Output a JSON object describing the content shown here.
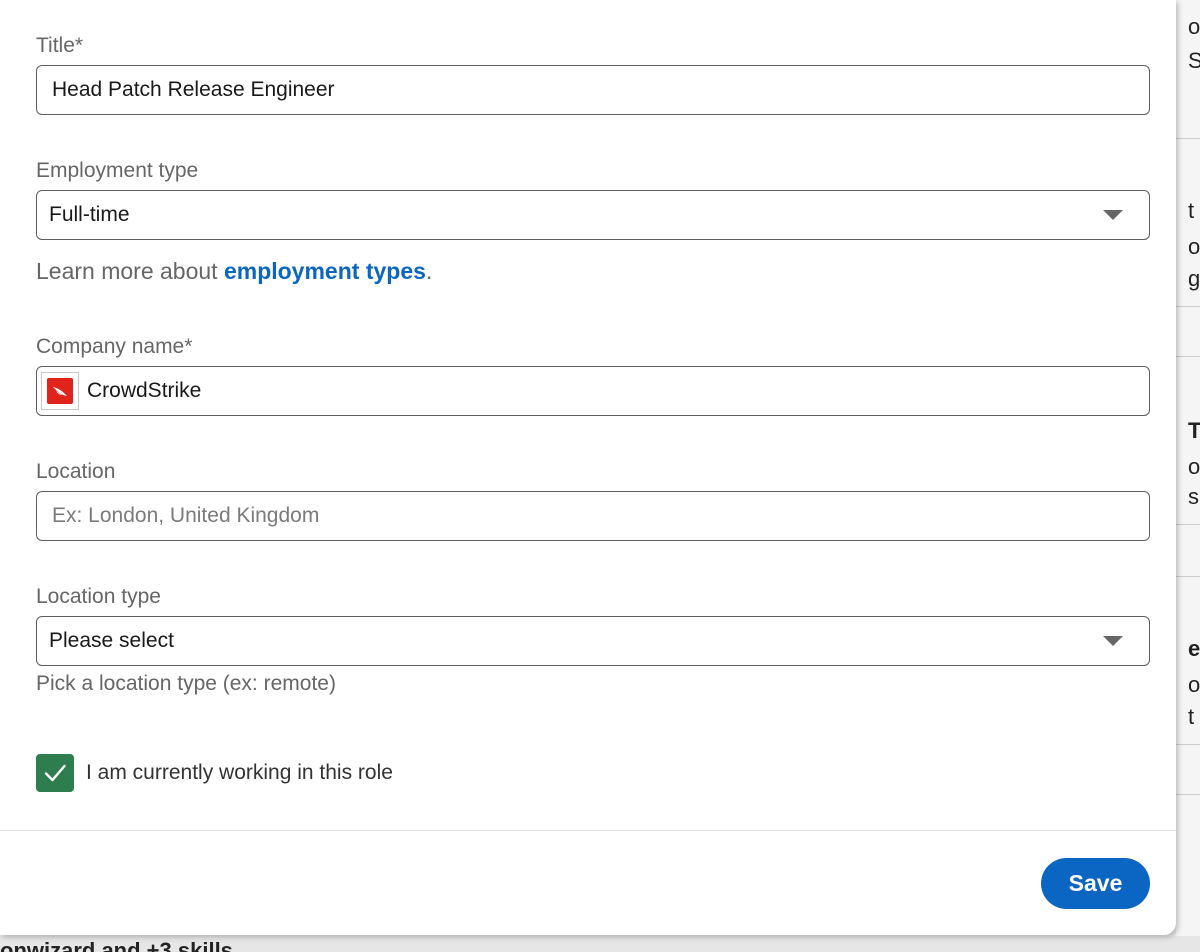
{
  "form": {
    "title_label": "Title*",
    "title_value": "Head Patch Release Engineer",
    "employment_type_label": "Employment type",
    "employment_type_value": "Full-time",
    "learn_more_prefix": "Learn more about ",
    "learn_more_link": "employment types",
    "learn_more_suffix": ".",
    "company_label": "Company name*",
    "company_value": "CrowdStrike",
    "company_logo_color": "#e0231b",
    "location_label": "Location",
    "location_placeholder": "Ex: London, United Kingdom",
    "location_type_label": "Location type",
    "location_type_value": "Please select",
    "location_type_helper": "Pick a location type (ex: remote)",
    "current_role_label": "I am currently working in this role",
    "current_role_checked": true
  },
  "footer": {
    "save_label": "Save"
  },
  "colors": {
    "accent": "#0a66c2",
    "checkbox": "#2e7d4f"
  },
  "background": {
    "right_fragments": [
      "o",
      "S",
      "t",
      "o",
      "g",
      "T",
      "o",
      "s",
      "e",
      "o",
      "t"
    ],
    "bottom_fragment": "onwizard and +3 skills"
  }
}
